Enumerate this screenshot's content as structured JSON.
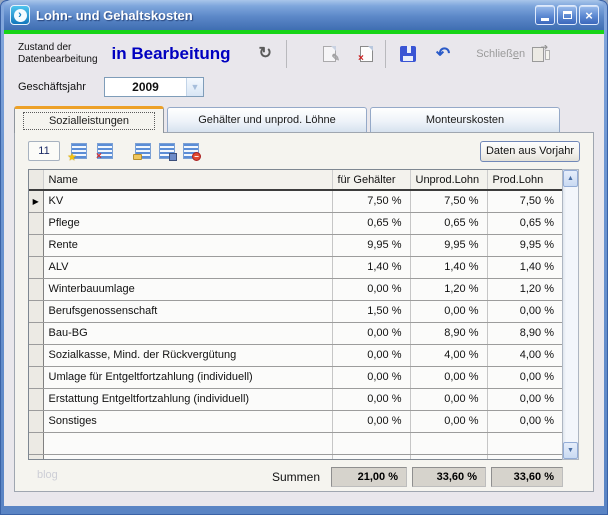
{
  "window": {
    "title": "Lohn- und Gehaltskosten"
  },
  "icons": {
    "app_arrow": "›",
    "close": "×",
    "refresh": "↻",
    "edit_pencil": "✎",
    "delete_cross": "×",
    "undo": "↶",
    "door_arrow": "➔",
    "combo_arrow": "▼",
    "star": "★",
    "grid_delete_cross": "×",
    "minus": "−",
    "row_marker": "▶",
    "scroll_up": "▲",
    "scroll_down": "▼"
  },
  "toolbar": {
    "state_label_line1": "Zustand der",
    "state_label_line2": "Datenbearbeitung",
    "state_value": "in Bearbeitung",
    "close_label_pre": "Schließ",
    "close_label_key": "e",
    "close_label_post": "n"
  },
  "fiscal_year": {
    "label": "Geschäftsjahr",
    "value": "2009"
  },
  "tabs": {
    "social": "Sozialleistungen",
    "salaries": "Gehälter und unprod. Löhne",
    "monteure": "Monteurskosten"
  },
  "grid_toolbar": {
    "count": "11",
    "prev_year_button": "Daten aus Vorjahr"
  },
  "table": {
    "columns": {
      "name": "Name",
      "gehaelter": "für Gehälter",
      "unprod": "Unprod.Lohn",
      "prod": "Prod.Lohn"
    },
    "rows": [
      {
        "name": "KV",
        "gehaelter": "7,50 %",
        "unprod": "7,50 %",
        "prod": "7,50 %"
      },
      {
        "name": "Pflege",
        "gehaelter": "0,65 %",
        "unprod": "0,65 %",
        "prod": "0,65 %"
      },
      {
        "name": "Rente",
        "gehaelter": "9,95 %",
        "unprod": "9,95 %",
        "prod": "9,95 %"
      },
      {
        "name": "ALV",
        "gehaelter": "1,40 %",
        "unprod": "1,40 %",
        "prod": "1,40 %"
      },
      {
        "name": "Winterbauumlage",
        "gehaelter": "0,00 %",
        "unprod": "1,20 %",
        "prod": "1,20 %"
      },
      {
        "name": "Berufsgenossenschaft",
        "gehaelter": "1,50 %",
        "unprod": "0,00 %",
        "prod": "0,00 %"
      },
      {
        "name": "Bau-BG",
        "gehaelter": "0,00 %",
        "unprod": "8,90 %",
        "prod": "8,90 %"
      },
      {
        "name": "Sozialkasse, Mind. der Rückvergütung",
        "gehaelter": "0,00 %",
        "unprod": "4,00 %",
        "prod": "4,00 %"
      },
      {
        "name": "Umlage für Entgeltfortzahlung (individuell)",
        "gehaelter": "0,00 %",
        "unprod": "0,00 %",
        "prod": "0,00 %"
      },
      {
        "name": "Erstattung Entgeltfortzahlung (individuell)",
        "gehaelter": "0,00 %",
        "unprod": "0,00 %",
        "prod": "0,00 %"
      },
      {
        "name": "Sonstiges",
        "gehaelter": "0,00 %",
        "unprod": "0,00 %",
        "prod": "0,00 %"
      },
      {
        "name": "",
        "gehaelter": "",
        "unprod": "",
        "prod": ""
      },
      {
        "name": "",
        "gehaelter": "",
        "unprod": "",
        "prod": ""
      }
    ]
  },
  "footer": {
    "summen_label": "Summen",
    "totals": {
      "gehaelter": "21,00 %",
      "unprod": "33,60 %",
      "prod": "33,60 %"
    },
    "watermark": "blog"
  }
}
